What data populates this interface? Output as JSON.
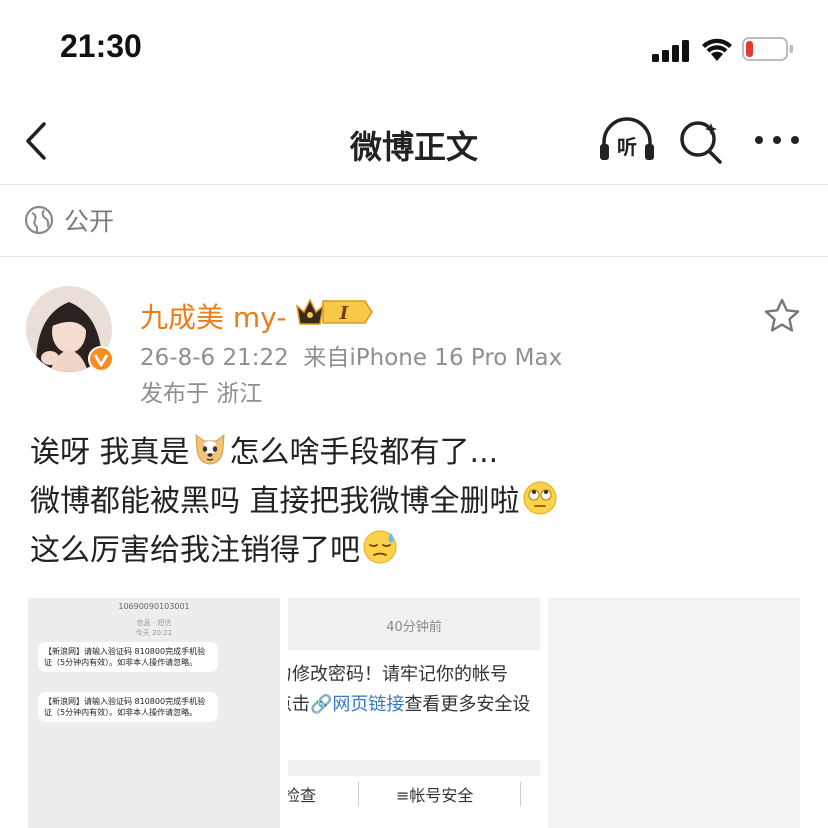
{
  "status_bar": {
    "time": "21:30",
    "battery_color": "#e53935"
  },
  "nav": {
    "title": "微博正文",
    "listen_label": "听"
  },
  "visibility": {
    "label": "公开"
  },
  "post": {
    "username": "九成美 my-",
    "member_badge": "I",
    "timestamp": "26-8-6 21:22",
    "source": "来自iPhone 16 Pro Max",
    "location": "发布于 浙江",
    "lines": [
      {
        "before": "诶呀 我真是",
        "emoji": "dog-emoji",
        "after": "怎么啥手段都有了..."
      },
      {
        "before": "微博都能被黑吗 直接把我微博全删啦",
        "emoji": "eye-roll-emoji",
        "after": ""
      },
      {
        "before": "这么厉害给我注销得了吧",
        "emoji": "sweat-emoji",
        "after": ""
      }
    ],
    "accent_color": "#ee7d18"
  },
  "images": {
    "sms": {
      "sender": "10690090103001",
      "info_line1": "信息 · 短信",
      "info_line2": "今天 20:22",
      "message1": "【新浪网】请输入验证码 810800完成手机验证（5分钟内有效）。如非本人操作请忽略。",
      "message2": "【新浪网】请输入验证码 810800完成手机验证（5分钟内有效）。如非本人操作请忽略。"
    },
    "notice": {
      "time": "40分钟前",
      "line1": "力修改密码！请牢记你的帐号",
      "line2_before": "点击",
      "line2_link": "网页链接",
      "line2_after": "查看更多安全设",
      "action1": "检查",
      "action2": "≡帐号安全"
    }
  }
}
